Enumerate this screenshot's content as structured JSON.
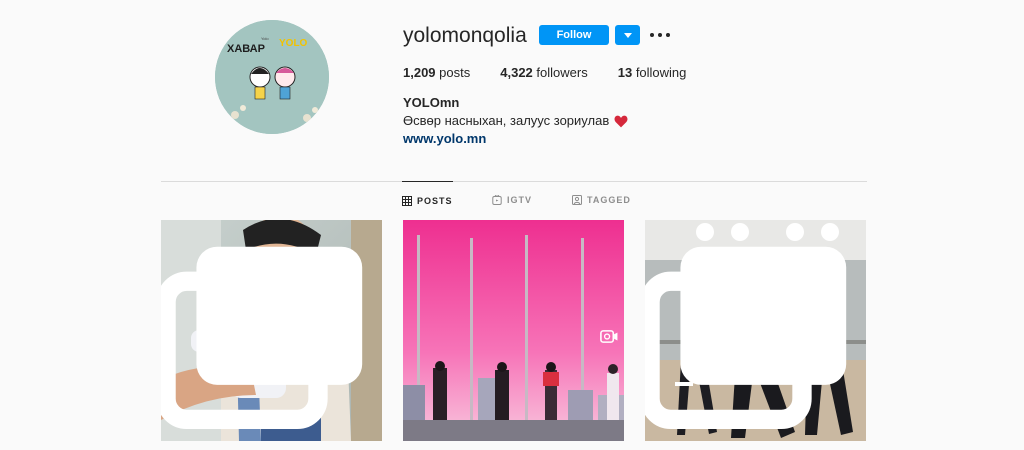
{
  "profile": {
    "username": "yolomonqolia",
    "follow_label": "Follow",
    "fullname": "YOLOmn",
    "bio": "Өсвөр насныхан, залуус зориулав",
    "website": "www.yolo.mn",
    "avatar_text": {
      "khabar": "ХАВАР",
      "yolo": "YOLO",
      "small": "Yolo"
    }
  },
  "stats": {
    "posts": {
      "count": "1,209",
      "label": "posts"
    },
    "followers": {
      "count": "4,322",
      "label": "followers"
    },
    "following": {
      "count": "13",
      "label": "following"
    }
  },
  "tabs": [
    {
      "label": "POSTS",
      "icon": "grid-icon",
      "active": true
    },
    {
      "label": "IGTV",
      "icon": "igtv-icon",
      "active": false
    },
    {
      "label": "TAGGED",
      "icon": "tagged-icon",
      "active": false
    }
  ],
  "posts": [
    {
      "type": "carousel",
      "badge_icon": "carousel-icon",
      "subject": "child-with-robot"
    },
    {
      "type": "video",
      "badge_icon": "video-icon",
      "subject": "people-on-pink-sky-poles"
    },
    {
      "type": "carousel",
      "badge_icon": "carousel-icon",
      "subject": "dancers-in-studio"
    }
  ],
  "colors": {
    "accent": "#0095f6",
    "link": "#00376b",
    "heart": "#ed4956"
  }
}
